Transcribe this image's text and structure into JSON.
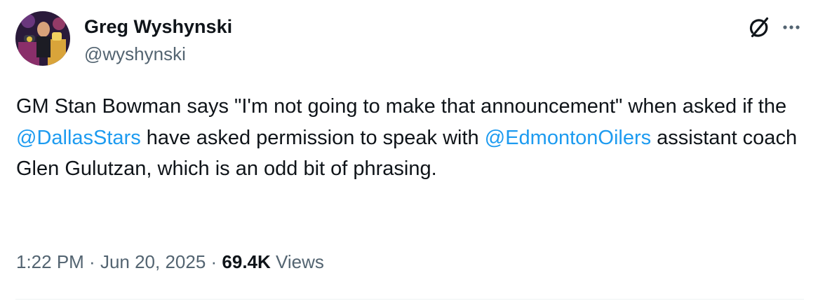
{
  "author": {
    "display_name": "Greg Wyshynski",
    "handle": "@wyshynski"
  },
  "tweet": {
    "text_part1": "GM Stan Bowman says \"I'm not going to make that announcement\" when asked if the ",
    "mention1": "@DallasStars",
    "text_part2": " have asked permission to speak with ",
    "mention2": "@EdmontonOilers",
    "text_part3": " assistant coach Glen Gulutzan, which is an odd bit of phrasing."
  },
  "meta": {
    "time": "1:22 PM",
    "separator": " · ",
    "date": "Jun 20, 2025",
    "views_count": "69.4K",
    "views_label": "Views"
  },
  "icons": {
    "grok": "grok-icon",
    "more": "more-icon"
  },
  "colors": {
    "link": "#1d9bf0",
    "secondary_text": "#536471",
    "primary_text": "#0f1419"
  }
}
